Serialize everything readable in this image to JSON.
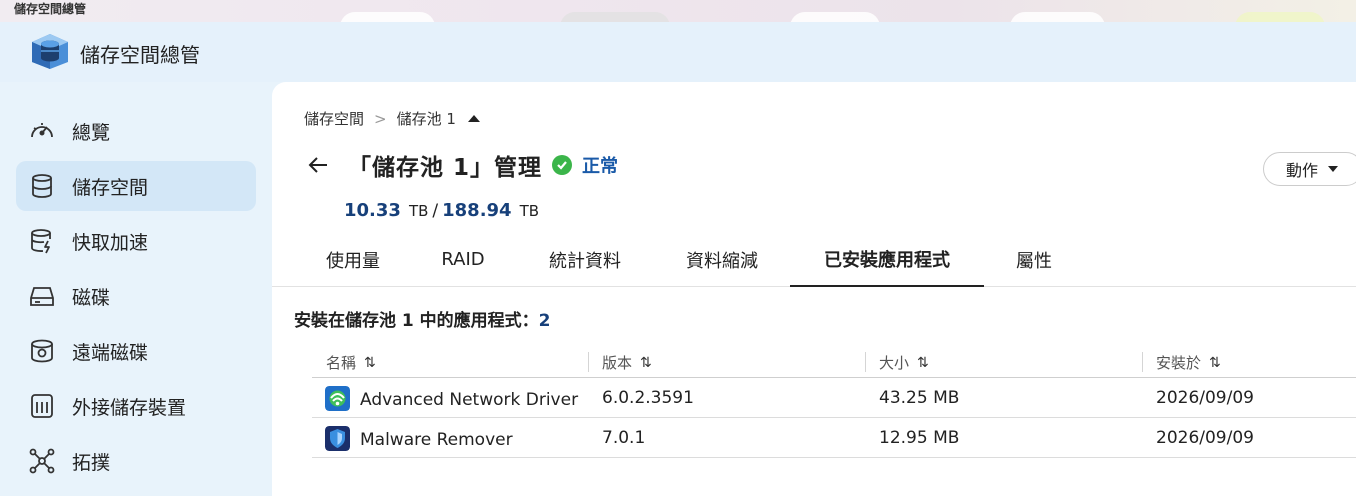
{
  "window": {
    "title": "儲存空間總管"
  },
  "app": {
    "title": "儲存空間總管"
  },
  "sidebar": {
    "items": [
      {
        "label": "總覽",
        "icon": "gauge-icon"
      },
      {
        "label": "儲存空間",
        "icon": "database-icon"
      },
      {
        "label": "快取加速",
        "icon": "cache-acceleration-icon"
      },
      {
        "label": "磁碟",
        "icon": "disk-drive-icon"
      },
      {
        "label": "遠端磁碟",
        "icon": "remote-disk-icon"
      },
      {
        "label": "外接儲存裝置",
        "icon": "external-storage-icon"
      },
      {
        "label": "拓撲",
        "icon": "topology-icon"
      }
    ],
    "active_index": 1
  },
  "breadcrumb": {
    "root": "儲存空間",
    "separator": ">",
    "current": "儲存池 1"
  },
  "header": {
    "title": "「儲存池 1」管理",
    "status": "正常",
    "status_color": "#3bb54a",
    "action_label": "動作"
  },
  "capacity": {
    "used": "10.33",
    "used_unit": "TB",
    "separator": "/",
    "total": "188.94",
    "total_unit": "TB"
  },
  "tabs": [
    {
      "label": "使用量"
    },
    {
      "label": "RAID"
    },
    {
      "label": "統計資料"
    },
    {
      "label": "資料縮減"
    },
    {
      "label": "已安裝應用程式"
    },
    {
      "label": "屬性"
    }
  ],
  "active_tab": 4,
  "apps_section": {
    "title_prefix": "安裝在儲存池 1 中的應用程式：",
    "count": "2"
  },
  "table": {
    "columns": [
      {
        "label": "名稱"
      },
      {
        "label": "版本"
      },
      {
        "label": "大小"
      },
      {
        "label": "安裝於"
      }
    ],
    "sort_icon": "sort-arrows-icon",
    "rows": [
      {
        "name": "Advanced Network Driver",
        "version": "6.0.2.3591",
        "size": "43.25 MB",
        "installed": "2026/09/09",
        "icon": "network-driver-icon"
      },
      {
        "name": "Malware Remover",
        "version": "7.0.1",
        "size": "12.95 MB",
        "installed": "2026/09/09",
        "icon": "malware-shield-icon"
      }
    ]
  },
  "colors": {
    "accent": "#17407a",
    "status_text": "#1a5aa8",
    "sidebar_bg": "#e8f3fb",
    "active_nav": "#d3e7f7"
  }
}
